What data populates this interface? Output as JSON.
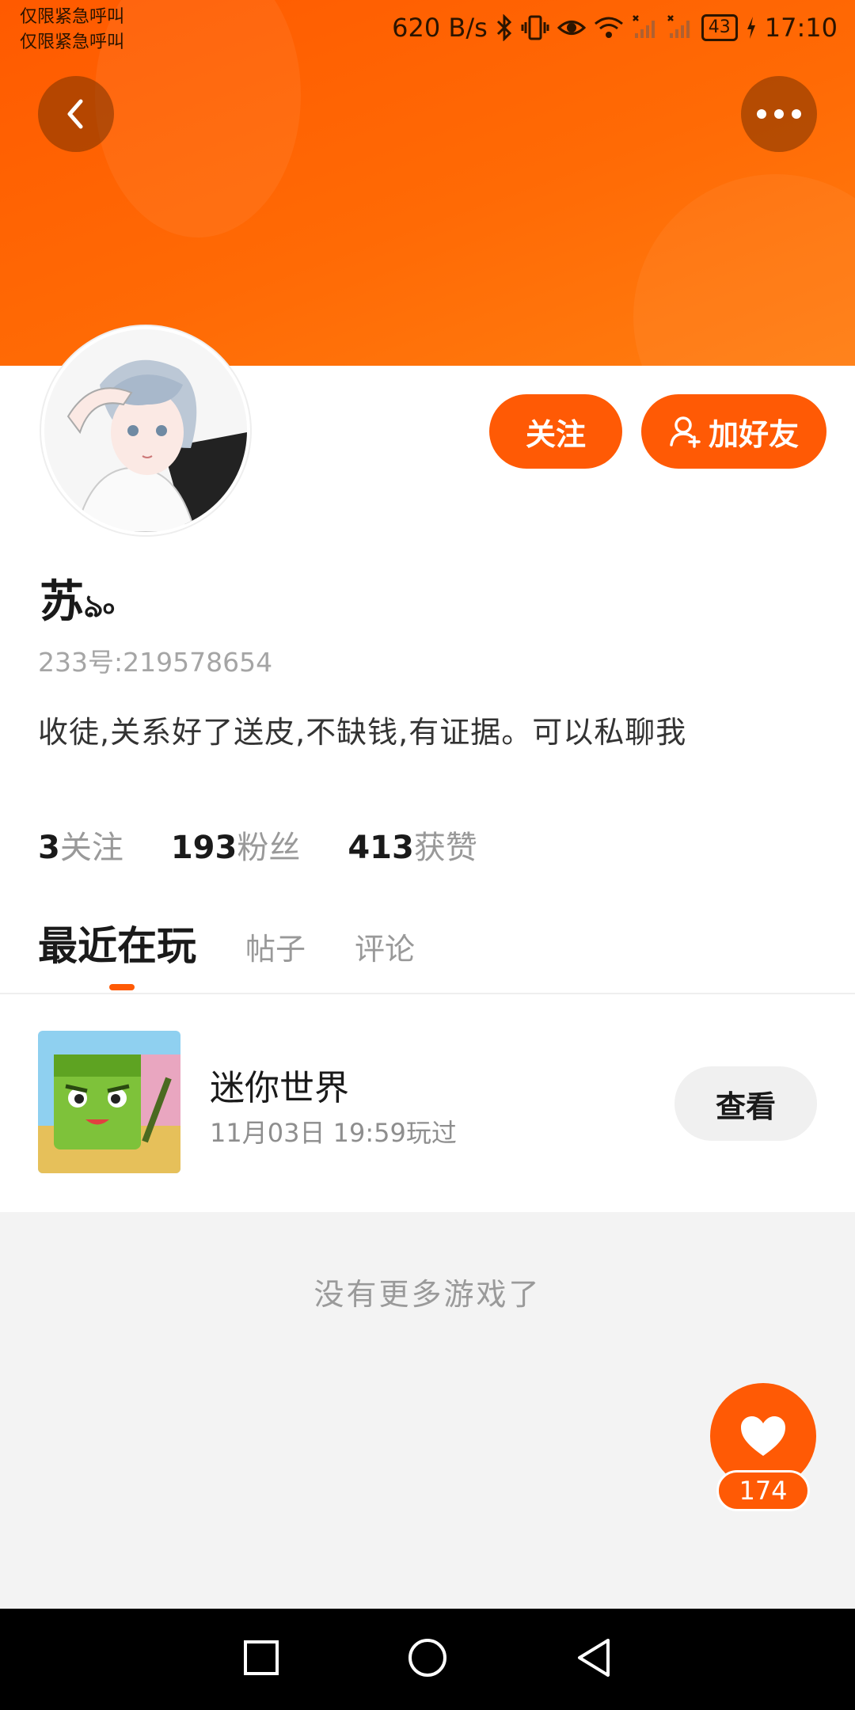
{
  "status_bar": {
    "emergency_line1": "仅限紧急呼叫",
    "emergency_line2": "仅限紧急呼叫",
    "speed": "620 B/s",
    "battery": "43",
    "time": "17:10"
  },
  "header": {
    "back_icon": "chevron-left-icon",
    "more_icon": "more-horizontal-icon"
  },
  "profile": {
    "name": "苏",
    "name_decoration": "ঌ৹",
    "id_text": "233号:219578654",
    "bio": "收徒,关系好了送皮,不缺钱,有证据。可以私聊我",
    "follow_label": "关注",
    "add_friend_label": "加好友"
  },
  "stats": [
    {
      "num": "3",
      "label": "关注"
    },
    {
      "num": "193",
      "label": "粉丝"
    },
    {
      "num": "413",
      "label": "获赞"
    }
  ],
  "tabs": [
    {
      "label": "最近在玩",
      "active": true
    },
    {
      "label": "帖子",
      "active": false
    },
    {
      "label": "评论",
      "active": false
    }
  ],
  "games": [
    {
      "name": "迷你世界",
      "time": "11月03日 19:59玩过",
      "action": "查看"
    }
  ],
  "no_more_text": "没有更多游戏了",
  "like": {
    "count": "174"
  },
  "colors": {
    "accent": "#ff5a05",
    "banner": "#ff6a05"
  }
}
